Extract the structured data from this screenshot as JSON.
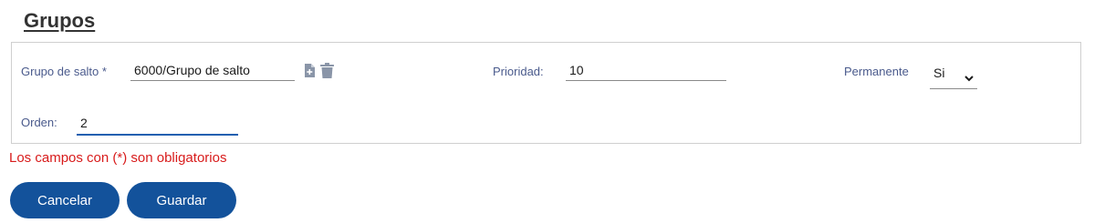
{
  "page": {
    "title": "Grupos"
  },
  "form": {
    "grupo_salto": {
      "label": "Grupo de salto *",
      "value": "6000/Grupo de salto"
    },
    "prioridad": {
      "label": "Prioridad:",
      "value": "10"
    },
    "permanente": {
      "label": "Permanente",
      "selected": "Si"
    },
    "orden": {
      "label": "Orden:",
      "value": "2"
    }
  },
  "validation": {
    "required_note": "Los campos con (*) son obligatorios"
  },
  "actions": {
    "cancel_label": "Cancelar",
    "save_label": "Guardar"
  },
  "colors": {
    "accent": "#13529b",
    "label": "#4a5a8c",
    "error": "#d81b1b",
    "icon": "#8a95a8"
  },
  "icons": {
    "add": "file-add-icon",
    "delete": "trash-icon",
    "dropdown": "chevron-down-icon"
  }
}
